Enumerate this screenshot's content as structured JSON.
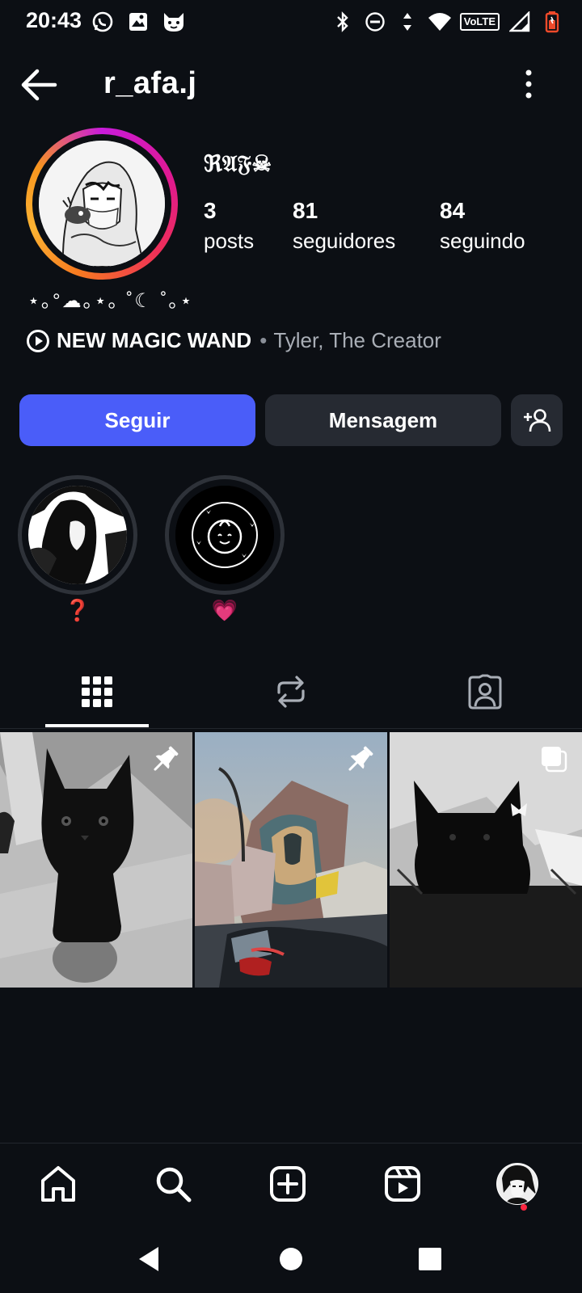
{
  "status_bar": {
    "time": "20:43",
    "left_icons": [
      "whatsapp-icon",
      "gallery-icon",
      "cat-face-icon"
    ],
    "right_icons": [
      "bluetooth-icon",
      "dnd-icon",
      "data-arrows-icon",
      "wifi-icon",
      "volte-badge",
      "signal-icon",
      "battery-icon"
    ],
    "volte": "VoLTE"
  },
  "header": {
    "username": "r_afa.j"
  },
  "profile": {
    "display_name": "ℜ𝔄𝔉☠",
    "decoration": "⋆｡°☁｡⋆｡ ˚☾ ˚｡⋆",
    "stats": [
      {
        "value": "3",
        "label": "posts"
      },
      {
        "value": "81",
        "label": "seguidores"
      },
      {
        "value": "84",
        "label": "seguindo"
      }
    ],
    "music": {
      "title": "NEW MAGIC WAND",
      "separator": "•",
      "artist": "Tyler, The Creator"
    }
  },
  "actions": {
    "follow_label": "Seguir",
    "message_label": "Mensagem",
    "add_user_icon": "add-person-icon"
  },
  "highlights": [
    {
      "label": "❓"
    },
    {
      "label": "💗"
    }
  ],
  "tabs": [
    "grid-icon",
    "reposts-icon",
    "tagged-icon"
  ],
  "posts": [
    {
      "badge": "pin-icon"
    },
    {
      "badge": "pin-icon"
    },
    {
      "badge": "carousel-icon"
    }
  ],
  "bottom_nav": [
    "home-icon",
    "search-icon",
    "create-icon",
    "reels-icon",
    "profile-avatar"
  ],
  "colors": {
    "background": "#0c0f14",
    "follow_button": "#4a5df9",
    "secondary_button": "#262a32",
    "notification_dot": "#ff2742"
  }
}
